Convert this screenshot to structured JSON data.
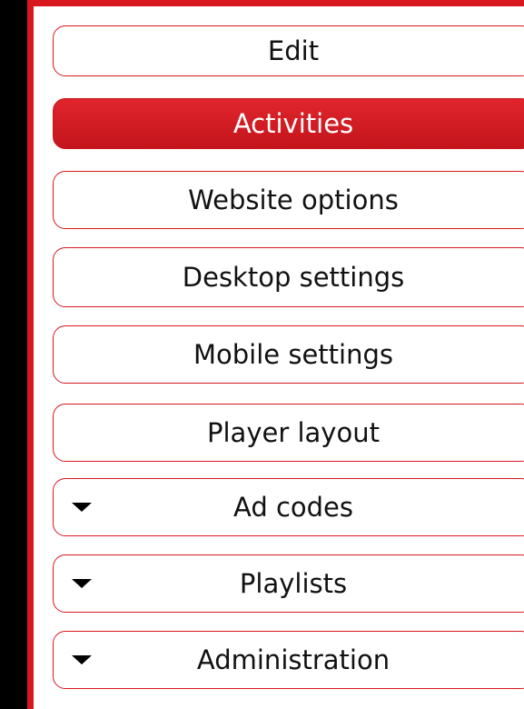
{
  "menu": {
    "items": [
      {
        "label": "Edit"
      },
      {
        "label": "Activities"
      },
      {
        "label": "Website options"
      },
      {
        "label": "Desktop settings"
      },
      {
        "label": "Mobile settings"
      },
      {
        "label": "Player layout"
      },
      {
        "label": "Ad codes"
      },
      {
        "label": "Playlists"
      },
      {
        "label": "Administration"
      }
    ],
    "active_item": "Activities"
  },
  "colors": {
    "accent": "#d7191f",
    "background": "#000000",
    "panel": "#ffffff"
  }
}
